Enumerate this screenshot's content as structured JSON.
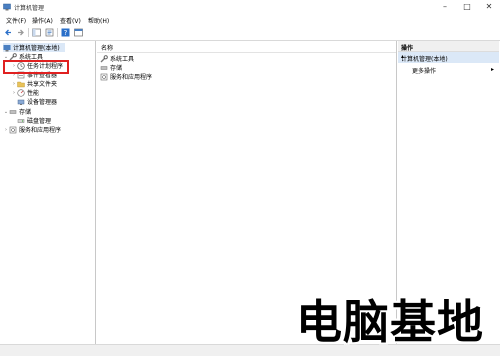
{
  "window": {
    "title": "计算机管理"
  },
  "menu": [
    "文件(F)",
    "操作(A)",
    "查看(V)",
    "帮助(H)"
  ],
  "toolbar": {
    "icons": [
      "back-arrow-icon",
      "forward-arrow-icon",
      "panel-icon",
      "properties-icon",
      "help-icon",
      "console-icon"
    ]
  },
  "tree": {
    "root": "计算机管理(本地)",
    "system_tools": "系统工具",
    "task_scheduler": "任务计划程序",
    "event_viewer": "事件查看器",
    "shared_folders": "共享文件夹",
    "performance": "性能",
    "device_manager": "设备管理器",
    "storage": "存储",
    "disk_management": "磁盘管理",
    "services_apps": "服务和应用程序"
  },
  "center": {
    "column_name": "名称",
    "items": [
      "系统工具",
      "存储",
      "服务和应用程序"
    ]
  },
  "actions": {
    "header": "操作",
    "section": "计算机管理(本地)",
    "more": "更多操作"
  },
  "watermark": "电脑基地",
  "colors": {
    "highlight": "#e02020",
    "selection": "#dbe8f7"
  }
}
